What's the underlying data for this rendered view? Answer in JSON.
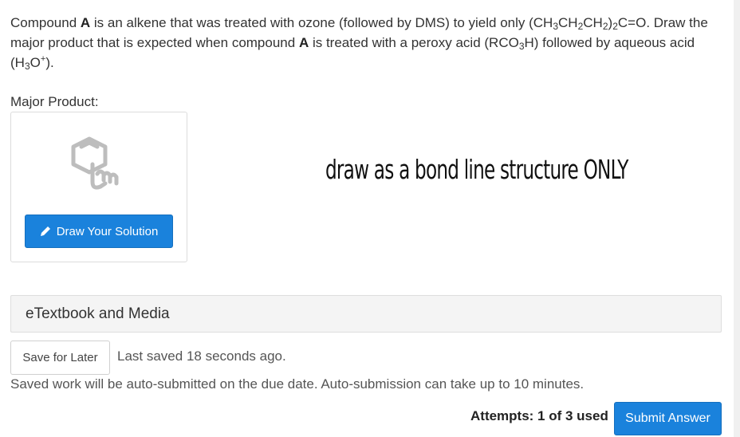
{
  "question": {
    "part1": "Compound ",
    "compound": "A",
    "part2": " is an alkene that was treated with ozone (followed by DMS) to yield only (CH",
    "sub3a": "3",
    "part3": "CH",
    "sub2a": "2",
    "part4": "CH",
    "sub2b": "2",
    "part5": ")",
    "sub2c": "2",
    "part6": "C=O. Draw the major product that is expected when compound ",
    "compound2": "A",
    "part7": " is treated with a peroxy acid (RCO",
    "sub3b": "3",
    "part8": "H) followed by aqueous acid (H",
    "sub3c": "3",
    "part9": "O",
    "sup_plus": "+",
    "part10": ")."
  },
  "major_product_label": "Major Product:",
  "draw_button_label": "Draw Your Solution",
  "note_text": "draw as a bond line structure ONLY",
  "etextbook_label": "eTextbook and Media",
  "save_button_label": "Save for Later",
  "last_saved_text": "Last saved 18 seconds ago.",
  "auto_submit_text": "Saved work will be auto-submitted on the due date. Auto-submission can take up to 10 minutes.",
  "attempts_text": "Attempts: 1 of 3 used",
  "submit_button_label": "Submit Answer",
  "icons": {
    "draw": "molecule-hand-icon",
    "pencil": "pencil-icon"
  },
  "colors": {
    "primary_button": "#1a82dc",
    "panel_bg": "#f4f4f4"
  }
}
